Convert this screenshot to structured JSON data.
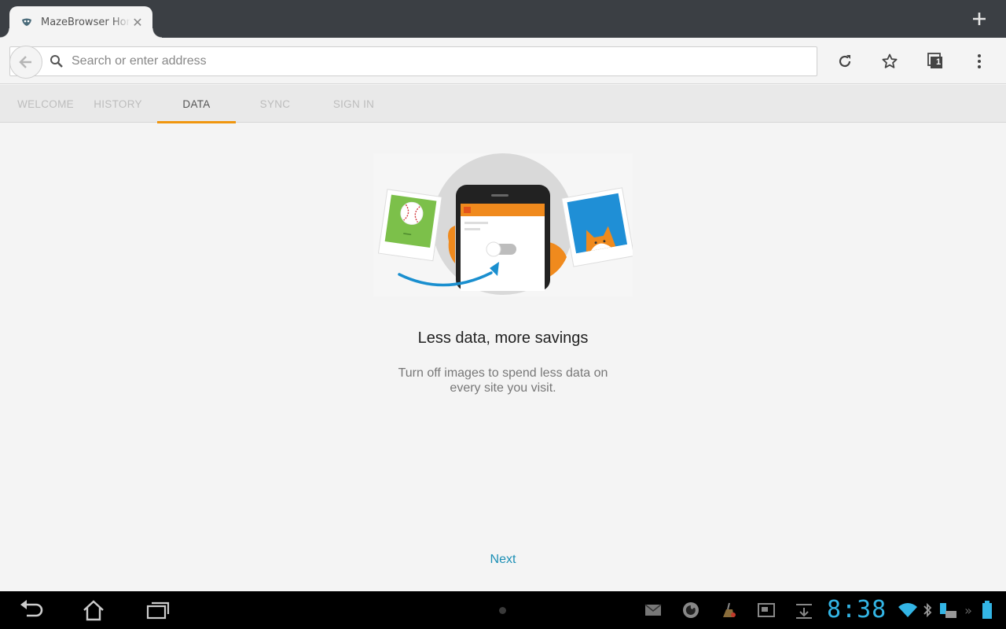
{
  "browser": {
    "tab": {
      "title": "MazeBrowser Home",
      "close_icon": "close-icon",
      "favicon": "mask-favicon-icon"
    },
    "new_tab_icon": "plus-icon",
    "toolbar": {
      "back_icon": "back-arrow-icon",
      "search_icon": "search-icon",
      "url_placeholder": "Search or enter address",
      "reload_icon": "reload-icon",
      "bookmark_icon": "star-icon",
      "tabs_count": "1",
      "menu_icon": "overflow-menu-icon"
    },
    "panel_tabs": [
      {
        "label": "WELCOME",
        "active": false
      },
      {
        "label": "HISTORY",
        "active": false
      },
      {
        "label": "DATA",
        "active": true
      },
      {
        "label": "SYNC",
        "active": false
      },
      {
        "label": "SIGN IN",
        "active": false
      }
    ],
    "accent_color": "#f0960e"
  },
  "onboarding": {
    "illustration": "phone-toggle-images-illustration",
    "headline": "Less data, more savings",
    "body": "Turn off images to spend less data on every site you visit.",
    "next_label": "Next",
    "link_color": "#1c8fb5"
  },
  "system_bar": {
    "clock": "8:38",
    "clock_color": "#33b5e5",
    "nav_icons": [
      "back-icon",
      "home-icon",
      "recent-apps-icon"
    ],
    "status_icons": [
      "email-icon",
      "firefox-icon",
      "cleaner-icon",
      "screenshot-icon",
      "download-icon",
      "wifi-icon",
      "bluetooth-icon",
      "keyboard-battery-icon",
      "battery-icon"
    ]
  }
}
